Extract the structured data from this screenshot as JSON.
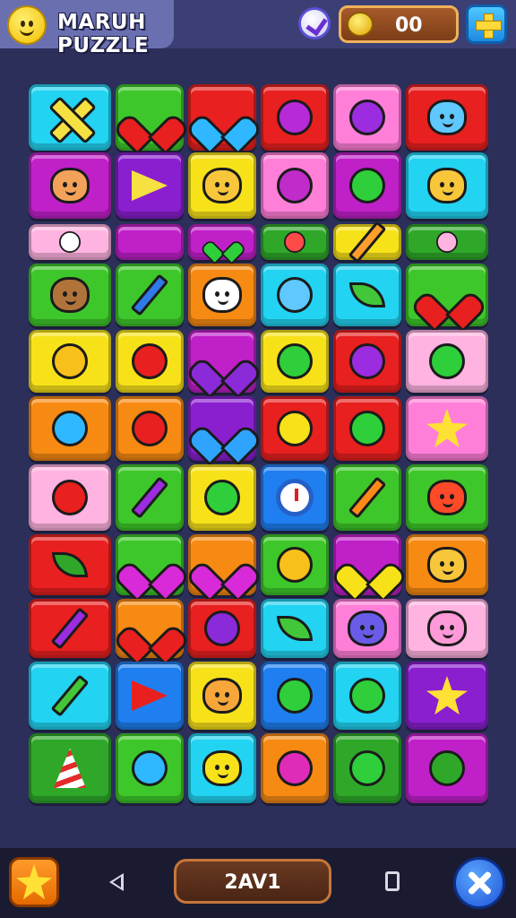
{
  "header": {
    "title": "MARUH PUZZLE",
    "score": "00"
  },
  "footer": {
    "level_label": "2AV1"
  },
  "colors": {
    "cyan": "#22d3f2",
    "green": "#3ec72a",
    "red": "#e8201f",
    "pink": "#ff7fd8",
    "magenta": "#c020c8",
    "yellow": "#f7e21a",
    "orange": "#f78a12",
    "lightpink": "#ffb3e0",
    "blue": "#1f7ff0",
    "darkgreen": "#2fa82a",
    "purple": "#8a1fd0"
  },
  "board": {
    "rows": [
      [
        [
          "cyan",
          "cross",
          "#f5e142"
        ],
        [
          "green",
          "heart",
          "#e8201f"
        ],
        [
          "red",
          "heart",
          "#2fb8ff"
        ],
        [
          "red",
          "circle",
          "#b72ad8"
        ],
        [
          "pink",
          "circle",
          "#9b2ce0"
        ],
        [
          "red",
          "face",
          "#5ec8ff"
        ]
      ],
      [
        [
          "magenta",
          "face",
          "#f3a25a"
        ],
        [
          "purple",
          "play",
          "#f5e142"
        ],
        [
          "yellow",
          "face",
          "#f7c63a"
        ],
        [
          "pink",
          "circle",
          "#c02bc9"
        ],
        [
          "magenta",
          "circle",
          "#2ecf3a"
        ],
        [
          "cyan",
          "face",
          "#f7c63a"
        ]
      ],
      [
        [
          "lightpink",
          "circle",
          "#ffffff"
        ],
        [
          "magenta",
          "none",
          ""
        ],
        [
          "magenta",
          "heart",
          "#2ecf3a"
        ],
        [
          "darkgreen",
          "circle",
          "#ff4a4a"
        ],
        [
          "yellow",
          "pencil",
          "#ff9e2a"
        ],
        [
          "darkgreen",
          "circle",
          "#ffb3e0"
        ]
      ],
      [
        [
          "green",
          "face",
          "#b0743a"
        ],
        [
          "green",
          "pencil",
          "#2f7ae8"
        ],
        [
          "orange",
          "face",
          "#ffffff"
        ],
        [
          "cyan",
          "circle",
          "#5ec8ff"
        ],
        [
          "cyan",
          "leaf",
          "#43c73a"
        ],
        [
          "green",
          "heart",
          "#e8201f"
        ]
      ],
      [
        [
          "yellow",
          "circle",
          "#f7c01a"
        ],
        [
          "yellow",
          "circle",
          "#e8201f"
        ],
        [
          "magenta",
          "heart",
          "#8a2ad8"
        ],
        [
          "yellow",
          "circle",
          "#2ecf3a"
        ],
        [
          "red",
          "circle",
          "#9b2ce0"
        ],
        [
          "lightpink",
          "circle",
          "#2ecf3a"
        ]
      ],
      [
        [
          "orange",
          "circle",
          "#2fb8ff"
        ],
        [
          "orange",
          "circle",
          "#e8201f"
        ],
        [
          "purple",
          "heart",
          "#2fa4ff"
        ],
        [
          "red",
          "circle",
          "#f7e21a"
        ],
        [
          "red",
          "circle",
          "#2ecf3a"
        ],
        [
          "pink",
          "star",
          "#f5e142"
        ]
      ],
      [
        [
          "lightpink",
          "circle",
          "#e8201f"
        ],
        [
          "green",
          "pencil",
          "#9b2ce0"
        ],
        [
          "yellow",
          "circle",
          "#2ecf3a"
        ],
        [
          "blue",
          "clock",
          "#ffffff"
        ],
        [
          "green",
          "pencil",
          "#ff8a1a"
        ],
        [
          "green",
          "face",
          "#ff4a2a"
        ]
      ],
      [
        [
          "red",
          "leaf",
          "#2fa82a"
        ],
        [
          "green",
          "heart",
          "#d82ad8"
        ],
        [
          "orange",
          "heart",
          "#d82ad8"
        ],
        [
          "green",
          "circle",
          "#f7c01a"
        ],
        [
          "magenta",
          "heart",
          "#f7e21a"
        ],
        [
          "orange",
          "face",
          "#f7c63a"
        ]
      ],
      [
        [
          "red",
          "pencil",
          "#9b2ce0"
        ],
        [
          "orange",
          "heart",
          "#e8201f"
        ],
        [
          "red",
          "circle",
          "#8a2ad8"
        ],
        [
          "cyan",
          "leaf",
          "#43c73a"
        ],
        [
          "pink",
          "face",
          "#6a5ce8"
        ],
        [
          "lightpink",
          "face",
          "#ff9ad8"
        ]
      ],
      [
        [
          "cyan",
          "pencil",
          "#43c73a"
        ],
        [
          "blue",
          "play",
          "#e8201f"
        ],
        [
          "yellow",
          "face",
          "#f7a63a"
        ],
        [
          "blue",
          "circle",
          "#2ecf3a"
        ],
        [
          "cyan",
          "circle",
          "#2ecf3a"
        ],
        [
          "purple",
          "star",
          "#f5e142"
        ]
      ],
      [
        [
          "darkgreen",
          "cone",
          "#e8201f"
        ],
        [
          "green",
          "circle",
          "#2fb8ff"
        ],
        [
          "cyan",
          "face",
          "#f7e21a"
        ],
        [
          "orange",
          "circle",
          "#e02ab8"
        ],
        [
          "darkgreen",
          "circle",
          "#2ecf3a"
        ],
        [
          "magenta",
          "circle",
          "#2fa82a"
        ]
      ]
    ]
  }
}
